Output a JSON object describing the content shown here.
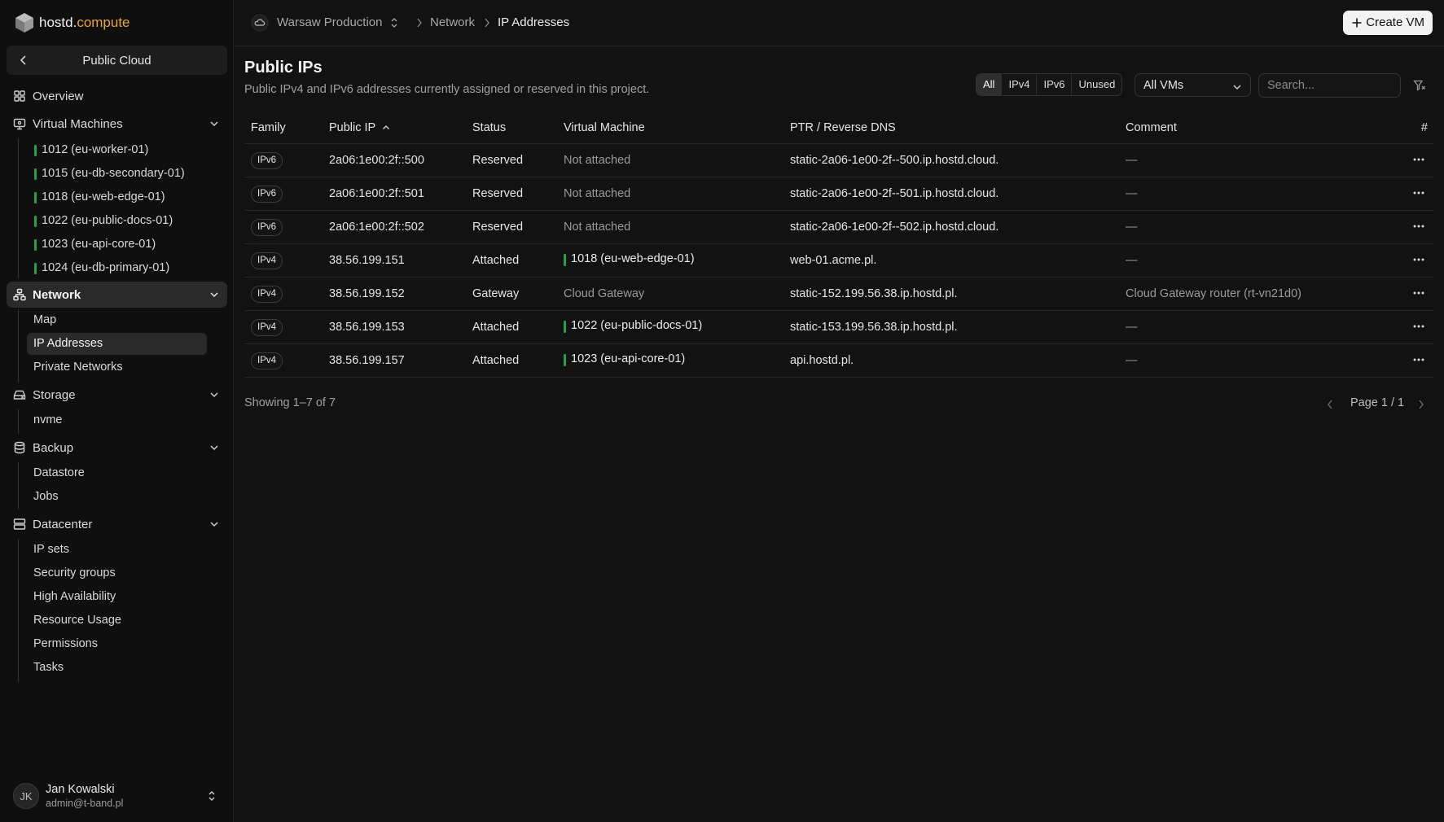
{
  "brand": {
    "name_main": "hostd.",
    "name_accent": "compute"
  },
  "project_switch": {
    "label": "Public Cloud"
  },
  "sidebar": {
    "overview": "Overview",
    "virtual_machines": "Virtual Machines",
    "vms": [
      "1012 (eu-worker-01)",
      "1015 (eu-db-secondary-01)",
      "1018 (eu-web-edge-01)",
      "1022 (eu-public-docs-01)",
      "1023 (eu-api-core-01)",
      "1024 (eu-db-primary-01)"
    ],
    "network": "Network",
    "network_items": [
      "Map",
      "IP Addresses",
      "Private Networks"
    ],
    "storage": "Storage",
    "storage_items": [
      "nvme"
    ],
    "backup": "Backup",
    "backup_items": [
      "Datastore",
      "Jobs"
    ],
    "datacenter": "Datacenter",
    "datacenter_items": [
      "IP sets",
      "Security groups",
      "High Availability",
      "Resource Usage",
      "Permissions",
      "Tasks"
    ]
  },
  "user": {
    "initials": "JK",
    "name": "Jan Kowalski",
    "email": "admin@t-band.pl"
  },
  "breadcrumb": {
    "project": "Warsaw Production",
    "section": "Network",
    "page": "IP Addresses"
  },
  "toolbar": {
    "create_vm": "Create VM"
  },
  "page": {
    "title": "Public IPs",
    "subtitle": "Public IPv4 and IPv6 addresses currently assigned or reserved in this project."
  },
  "filters": {
    "segments": [
      "All",
      "IPv4",
      "IPv6",
      "Unused"
    ],
    "active_segment": "All",
    "vm_select": "All VMs",
    "search_placeholder": "Search..."
  },
  "table": {
    "headers": [
      "Family",
      "Public IP",
      "Status",
      "Virtual Machine",
      "PTR / Reverse DNS",
      "Comment",
      "#"
    ],
    "rows": [
      {
        "family": "IPv6",
        "ip": "2a06:1e00:2f::500",
        "status": "Reserved",
        "vm": "Not attached",
        "vm_linked": false,
        "ptr": "static-2a06-1e00-2f--500.ip.hostd.cloud.",
        "comment": "—"
      },
      {
        "family": "IPv6",
        "ip": "2a06:1e00:2f::501",
        "status": "Reserved",
        "vm": "Not attached",
        "vm_linked": false,
        "ptr": "static-2a06-1e00-2f--501.ip.hostd.cloud.",
        "comment": "—"
      },
      {
        "family": "IPv6",
        "ip": "2a06:1e00:2f::502",
        "status": "Reserved",
        "vm": "Not attached",
        "vm_linked": false,
        "ptr": "static-2a06-1e00-2f--502.ip.hostd.cloud.",
        "comment": "—"
      },
      {
        "family": "IPv4",
        "ip": "38.56.199.151",
        "status": "Attached",
        "vm": "1018 (eu-web-edge-01)",
        "vm_linked": true,
        "ptr": "web-01.acme.pl.",
        "comment": "—"
      },
      {
        "family": "IPv4",
        "ip": "38.56.199.152",
        "status": "Gateway",
        "vm": "Cloud Gateway",
        "vm_linked": false,
        "ptr": "static-152.199.56.38.ip.hostd.pl.",
        "comment": "Cloud Gateway router (rt-vn21d0)"
      },
      {
        "family": "IPv4",
        "ip": "38.56.199.153",
        "status": "Attached",
        "vm": "1022 (eu-public-docs-01)",
        "vm_linked": true,
        "ptr": "static-153.199.56.38.ip.hostd.pl.",
        "comment": "—"
      },
      {
        "family": "IPv4",
        "ip": "38.56.199.157",
        "status": "Attached",
        "vm": "1023 (eu-api-core-01)",
        "vm_linked": true,
        "ptr": "api.hostd.pl.",
        "comment": "—"
      }
    ]
  },
  "footer": {
    "showing": "Showing 1–7 of 7",
    "page": "Page 1 / 1"
  },
  "colors": {
    "background": "#121212",
    "sidebar": "#0f0f0f",
    "accent": "#e8a43a",
    "vm_running": "#22a14a"
  }
}
